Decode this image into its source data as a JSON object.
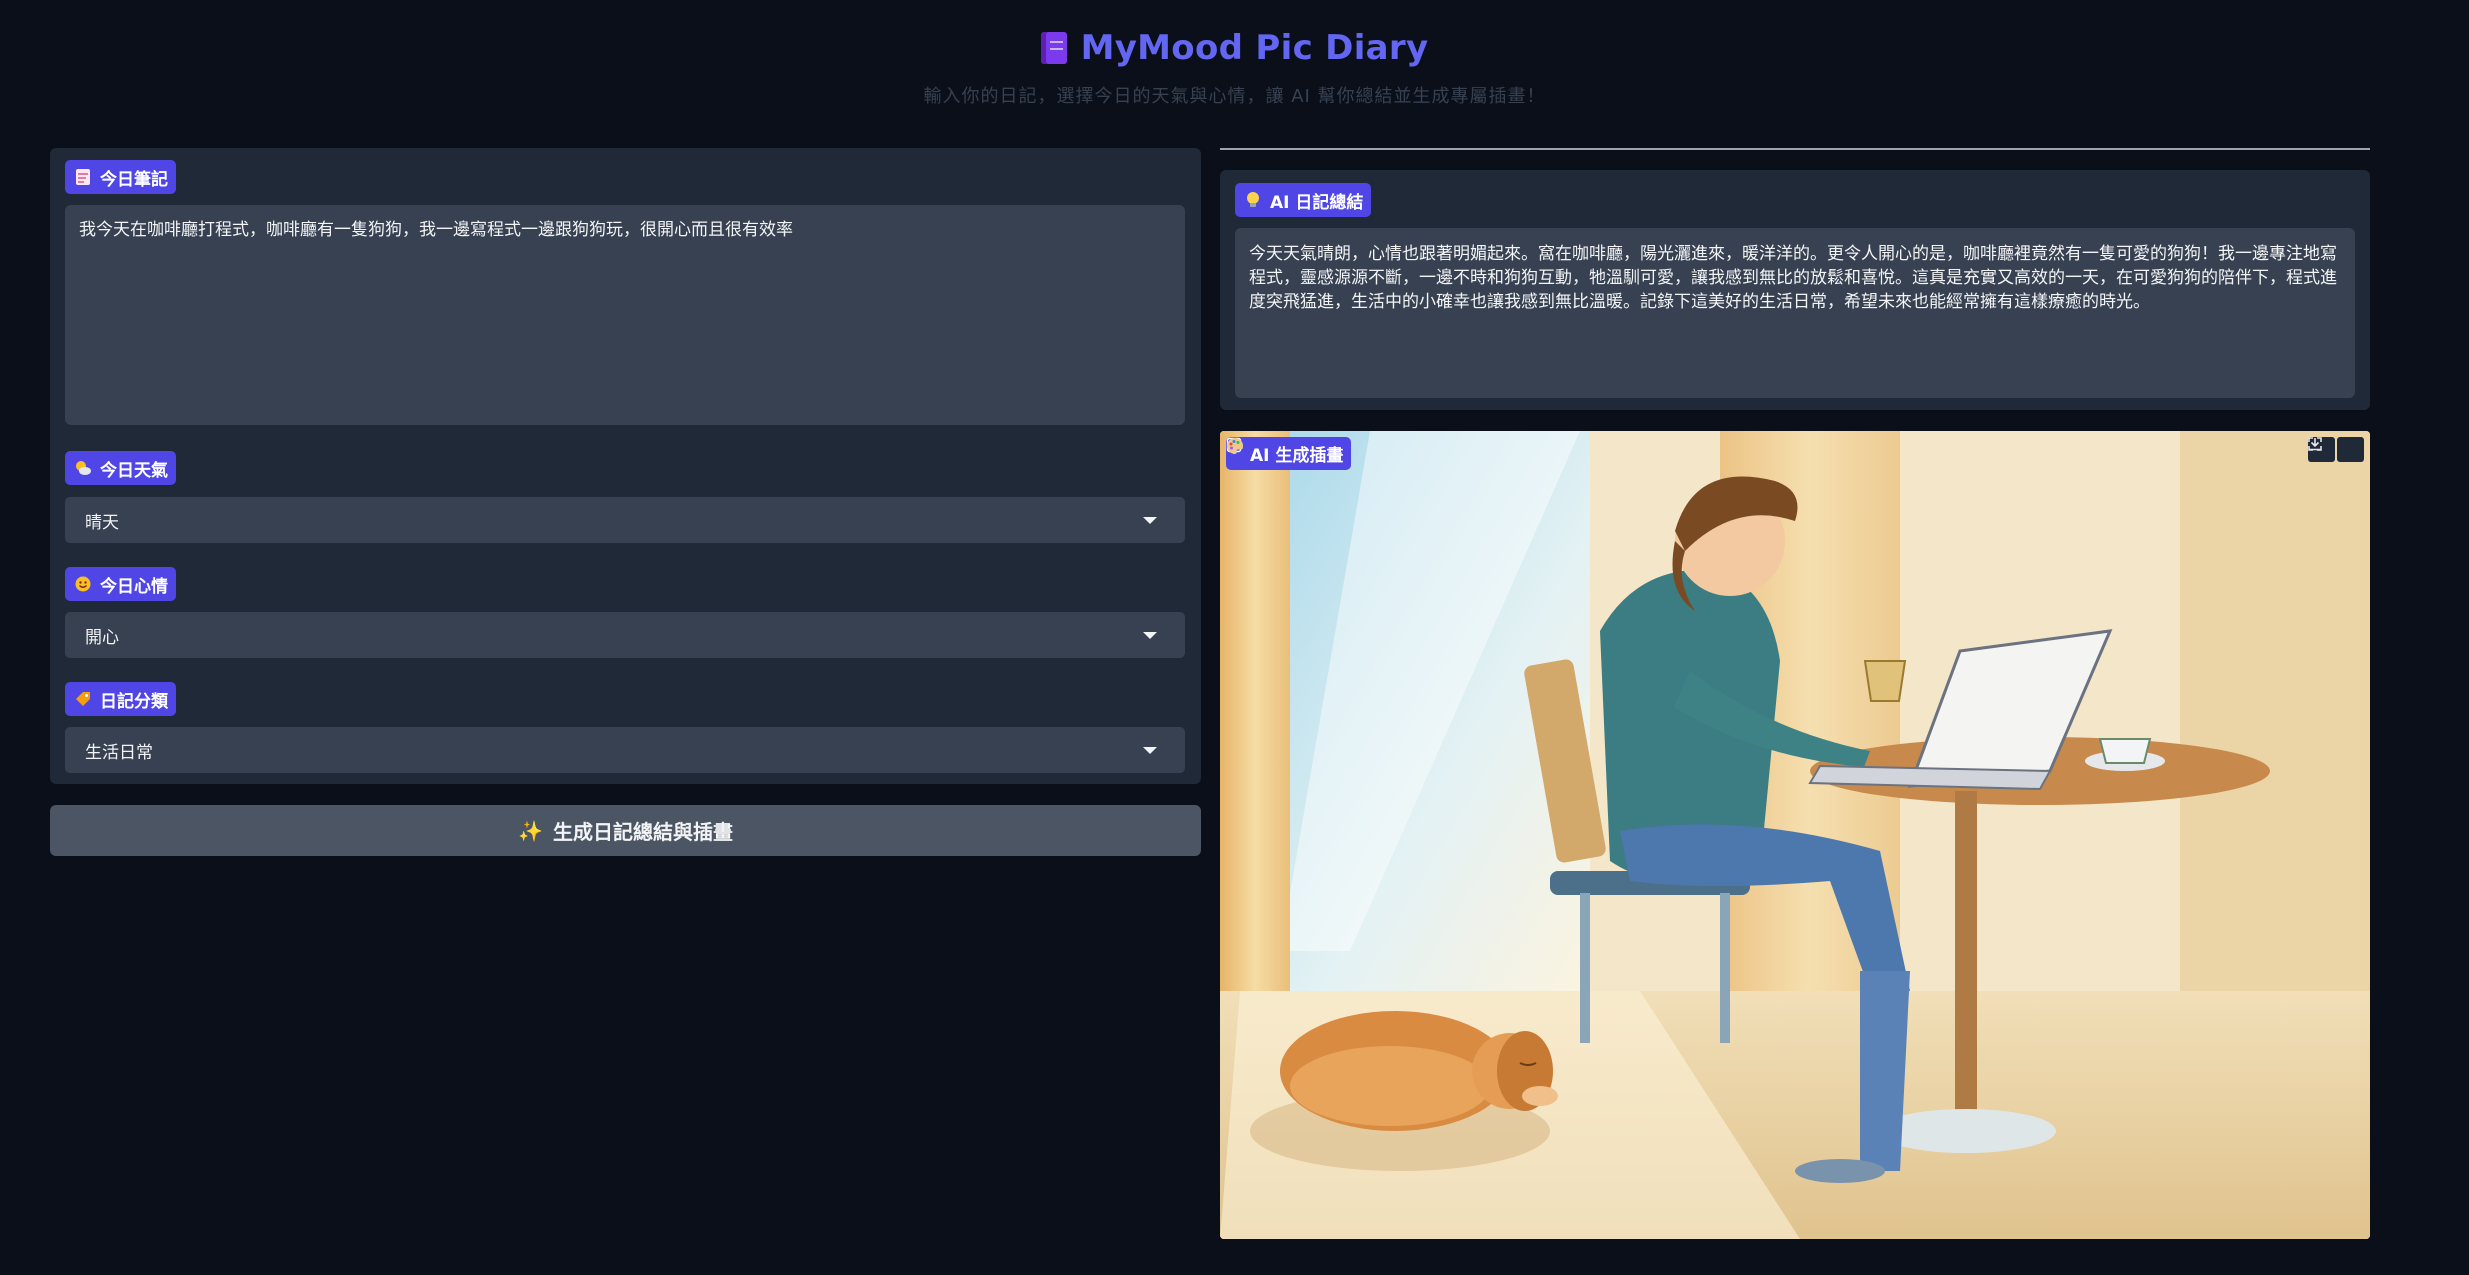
{
  "header": {
    "title": "MyMood Pic Diary",
    "subtitle": "輸入你的日記，選擇今日的天氣與心情，讓 AI 幫你總結並生成專屬插畫！"
  },
  "notes": {
    "label": "今日筆記",
    "value": "我今天在咖啡廳打程式，咖啡廳有一隻狗狗，我一邊寫程式一邊跟狗狗玩，很開心而且很有效率"
  },
  "weather": {
    "label": "今日天氣",
    "value": "晴天"
  },
  "mood": {
    "label": "今日心情",
    "value": "開心"
  },
  "category": {
    "label": "日記分類",
    "value": "生活日常"
  },
  "generate_button": {
    "icon": "✨",
    "label": "生成日記總結與插畫"
  },
  "summary": {
    "label": "AI 日記總結",
    "text": "今天天氣晴朗，心情也跟著明媚起來。窩在咖啡廳，陽光灑進來，暖洋洋的。更令人開心的是，咖啡廳裡竟然有一隻可愛的狗狗！我一邊專注地寫程式，靈感源源不斷，一邊不時和狗狗互動，牠溫馴可愛，讓我感到無比的放鬆和喜悅。這真是充實又高效的一天，在可愛狗狗的陪伴下，程式進度突飛猛進，生活中的小確幸也讓我感到無比溫暖。記錄下這美好的生活日常，希望未來也能經常擁有這樣療癒的時光。"
  },
  "illustration": {
    "label": "AI 生成插畫"
  },
  "icons": {
    "title": "notebook-icon",
    "notes": "memo-icon",
    "weather": "sun-behind-cloud-icon",
    "mood": "smiling-face-icon",
    "category": "label-tag-icon",
    "summary": "light-bulb-icon",
    "illustration": "artist-palette-icon"
  },
  "colors": {
    "accent": "#4f46e5",
    "title": "#6366f1",
    "background": "#0b0f19",
    "panel": "#1f2937",
    "input": "#374151"
  }
}
